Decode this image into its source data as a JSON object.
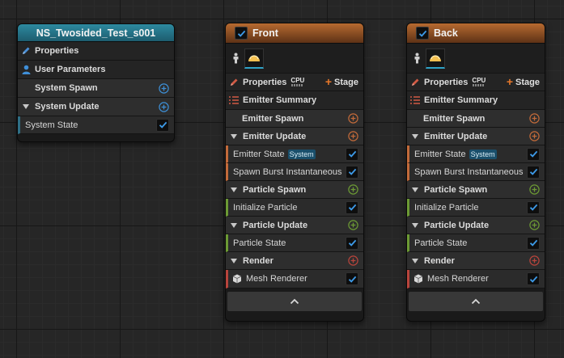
{
  "system_node": {
    "title": "NS_Twosided_Test_s001",
    "properties_label": "Properties",
    "user_parameters_label": "User Parameters",
    "system_spawn_label": "System Spawn",
    "system_update_label": "System Update",
    "system_state_label": "System State",
    "system_state_checked": true
  },
  "emitters": [
    {
      "title": "Front",
      "enabled": true,
      "properties_label": "Properties",
      "cpu_label": "CPU",
      "stage_label": "Stage",
      "emitter_summary_label": "Emitter Summary",
      "emitter_spawn_label": "Emitter Spawn",
      "emitter_update_label": "Emitter Update",
      "emitter_state_label": "Emitter State",
      "emitter_state_badge": "System",
      "spawn_burst_label": "Spawn Burst Instantaneous",
      "particle_spawn_label": "Particle Spawn",
      "initialize_particle_label": "Initialize Particle",
      "particle_update_label": "Particle Update",
      "particle_state_label": "Particle State",
      "render_label": "Render",
      "mesh_renderer_label": "Mesh Renderer"
    },
    {
      "title": "Back",
      "enabled": true,
      "properties_label": "Properties",
      "cpu_label": "CPU",
      "stage_label": "Stage",
      "emitter_summary_label": "Emitter Summary",
      "emitter_spawn_label": "Emitter Spawn",
      "emitter_update_label": "Emitter Update",
      "emitter_state_label": "Emitter State",
      "emitter_state_badge": "System",
      "spawn_burst_label": "Spawn Burst Instantaneous",
      "particle_spawn_label": "Particle Spawn",
      "initialize_particle_label": "Initialize Particle",
      "particle_update_label": "Particle Update",
      "particle_state_label": "Particle State",
      "render_label": "Render",
      "mesh_renderer_label": "Mesh Renderer"
    }
  ],
  "colors": {
    "system_header": "#2d8aa0",
    "emitter_header": "#b76a30",
    "check_blue": "#3d9ae8",
    "spawn_update_orange": "#c26a3a",
    "particle_green": "#6c9a34",
    "render_red": "#b8443c"
  },
  "icons": {
    "pencil": "pencil-icon",
    "user": "user-icon",
    "plus_circle": "plus-circle-icon",
    "checkmark": "checkmark-icon",
    "list": "list-icon",
    "cube": "cube-icon",
    "chevron_up": "chevron-up-icon"
  }
}
